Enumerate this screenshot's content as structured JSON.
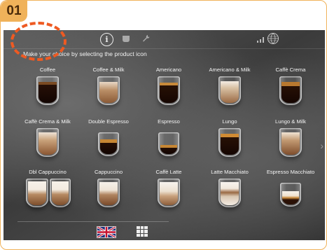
{
  "step_badge": "01",
  "colors": {
    "badge": "#f0b25a",
    "annotation": "#ee5a22"
  },
  "topbar": {
    "icons": [
      "info-icon",
      "cup-icon",
      "wrench-icon",
      "signal-icon",
      "globe-icon"
    ],
    "info_glyph": "i"
  },
  "instruction": "Make your choice by selecting the product icon",
  "products": [
    {
      "label": "Coffee"
    },
    {
      "label": "Coffee & Milk"
    },
    {
      "label": "Americano"
    },
    {
      "label": "Americano & Milk"
    },
    {
      "label": "Caffè Crema"
    },
    {
      "label": "Caffè Crema & Milk"
    },
    {
      "label": "Double Espresso"
    },
    {
      "label": "Espresso"
    },
    {
      "label": "Lungo"
    },
    {
      "label": "Lungo & Milk"
    },
    {
      "label": "Dbl Cappuccino"
    },
    {
      "label": "Cappuccino"
    },
    {
      "label": "Caffè Latte"
    },
    {
      "label": "Latte Macchiato"
    },
    {
      "label": "Espresso Macchiato"
    }
  ],
  "nav": {
    "next_arrow": "›"
  },
  "bottombar": {
    "icons": [
      "uk-flag-icon",
      "grid-menu-icon"
    ]
  }
}
